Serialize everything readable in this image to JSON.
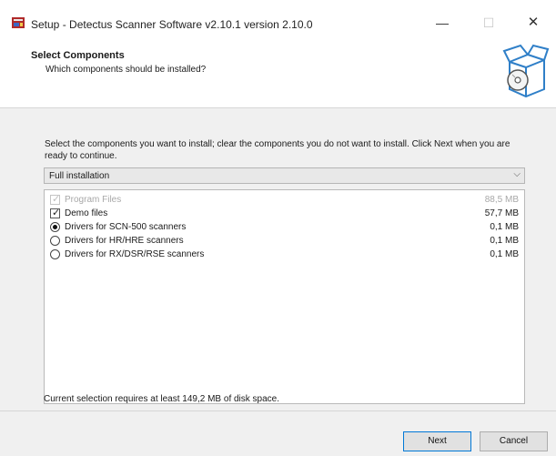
{
  "window": {
    "title": "Setup - Detectus Scanner Software v2.10.1 version 2.10.0",
    "minimize_glyph": "—",
    "maximize_glyph": "☐",
    "close_glyph": "✕"
  },
  "header": {
    "title": "Select Components",
    "subtitle": "Which components should be installed?"
  },
  "instructions": "Select the components you want to install; clear the components you do not want to install. Click Next when you are ready to continue.",
  "install_type": {
    "selected": "Full installation"
  },
  "components": [
    {
      "label": "Program Files",
      "size": "88,5 MB",
      "control": "checkbox",
      "checked": true,
      "disabled": true
    },
    {
      "label": "Demo files",
      "size": "57,7 MB",
      "control": "checkbox",
      "checked": true,
      "disabled": false
    },
    {
      "label": "Drivers for SCN-500 scanners",
      "size": "0,1 MB",
      "control": "radio",
      "checked": true,
      "disabled": false
    },
    {
      "label": "Drivers for HR/HRE scanners",
      "size": "0,1 MB",
      "control": "radio",
      "checked": false,
      "disabled": false
    },
    {
      "label": "Drivers for RX/DSR/RSE scanners",
      "size": "0,1 MB",
      "control": "radio",
      "checked": false,
      "disabled": false
    }
  ],
  "disk_requirement": "Current selection requires at least 149,2 MB of disk space.",
  "buttons": {
    "next": "Next",
    "cancel": "Cancel"
  },
  "colors": {
    "accent": "#0078d7",
    "disabled_text": "#a8a8a8"
  }
}
